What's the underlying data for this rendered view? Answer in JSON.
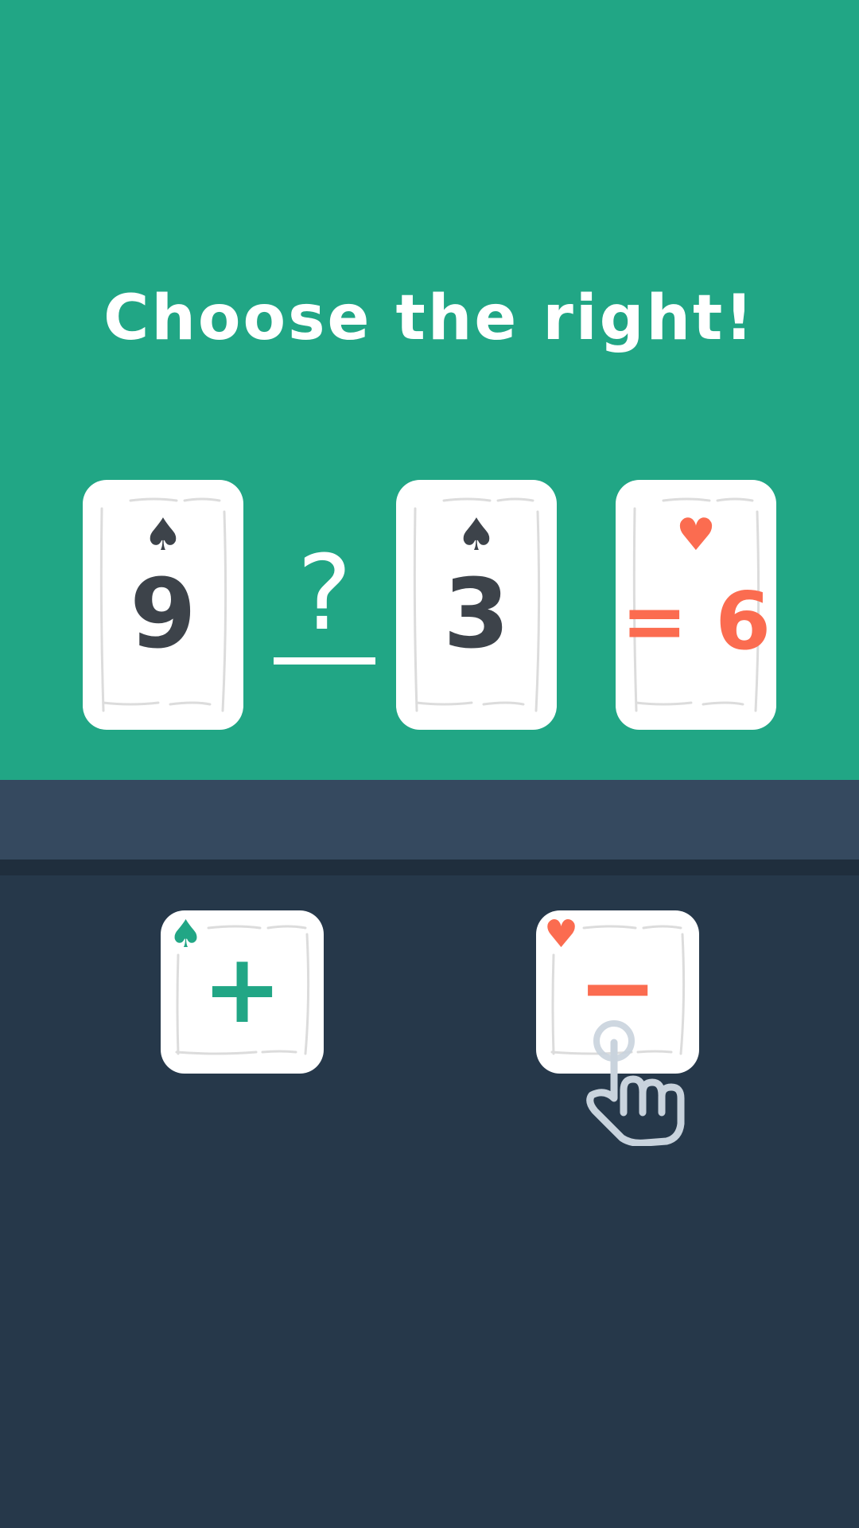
{
  "title": "Choose the right!",
  "equation": {
    "left": {
      "suit": "♠",
      "value": "9"
    },
    "operator_placeholder": "?",
    "right": {
      "suit": "♠",
      "value": "3"
    },
    "result": {
      "suit": "♥",
      "value": "= 6"
    }
  },
  "choices": [
    {
      "suit": "♠",
      "symbol": "+"
    },
    {
      "suit": "♥",
      "symbol": "−"
    }
  ],
  "colors": {
    "top_background": "#21a685",
    "bottom_background": "#26384a",
    "card_text_dark": "#3d434a",
    "accent_red": "#fb6c50",
    "accent_green": "#21a685"
  },
  "icons": {
    "hint": "pointing-hand-icon"
  }
}
